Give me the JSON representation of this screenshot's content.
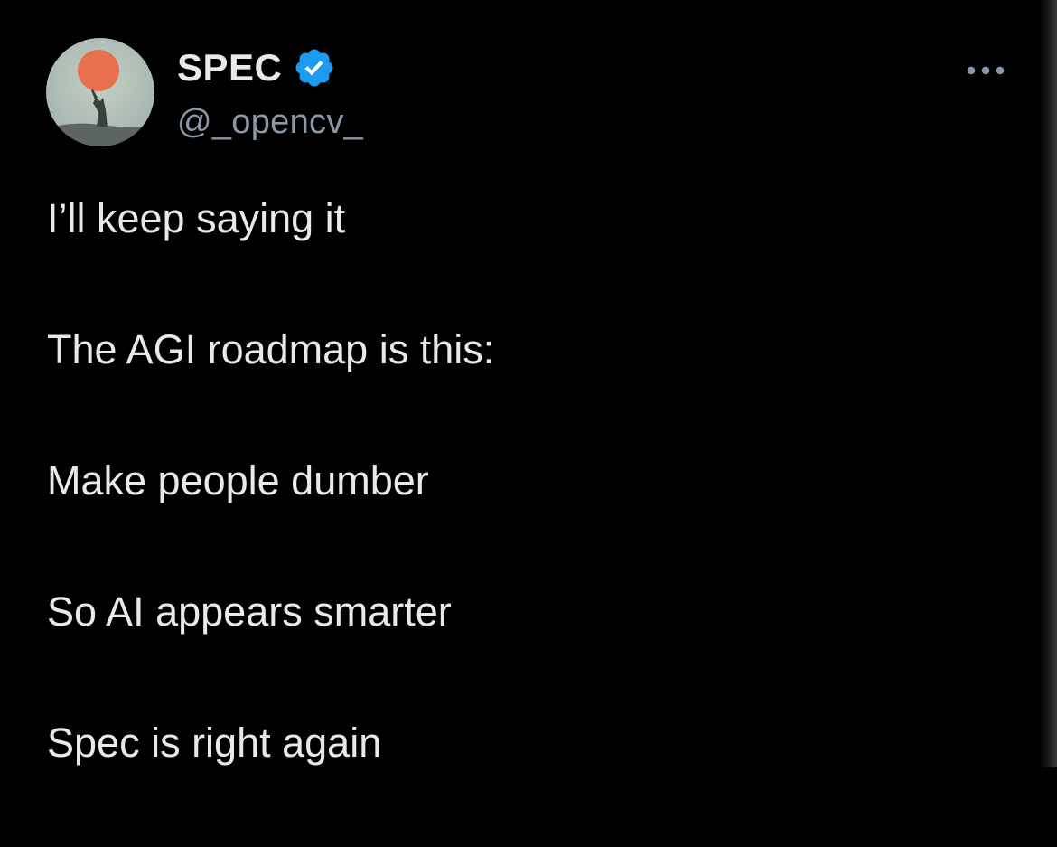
{
  "author": {
    "display_name": "SPEC",
    "handle": "@_opencv_",
    "verified": true,
    "avatar_icon": "avatar-sunset-figure"
  },
  "menu": {
    "icon": "more-horizontal-icon"
  },
  "tweet": {
    "lines": [
      "I’ll keep saying it",
      "The AGI roadmap is this:",
      "Make people dumber",
      "So AI appears smarter",
      "Spec is right again"
    ]
  },
  "colors": {
    "background": "#000000",
    "text_primary": "#e7e9ea",
    "text_secondary": "#8b98a5",
    "verified_blue": "#1d9bf0"
  }
}
